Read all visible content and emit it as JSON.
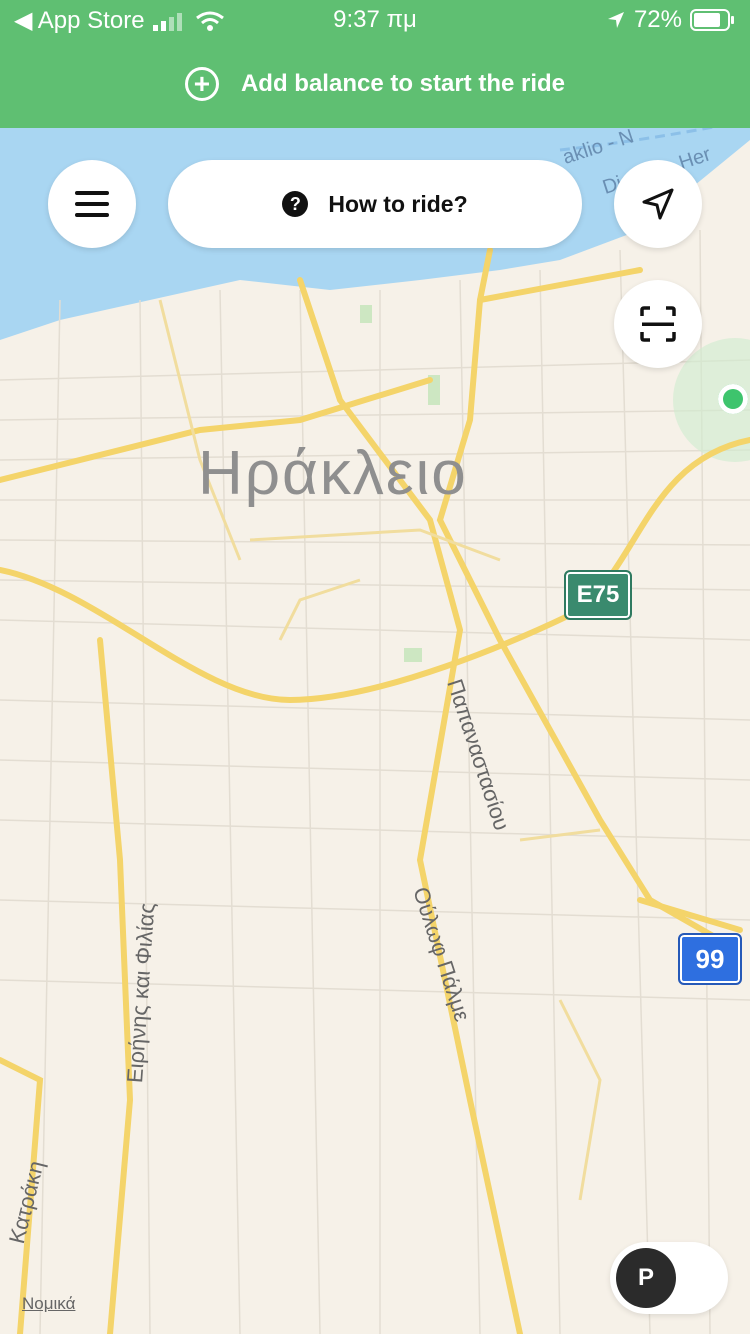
{
  "status_bar": {
    "back_label": "◀ App Store",
    "time": "9:37 πμ",
    "battery_percent": "72%"
  },
  "banner": {
    "label": "Add balance to start the ride"
  },
  "how_to_ride": {
    "label": "How to ride?"
  },
  "map": {
    "city_label": "Ηράκλειο",
    "port_label_1": "aklio - N",
    "port_label_2": "Diafani - Her",
    "shield_e75": "E75",
    "shield_99": "99",
    "street_1": "Παπαναστασίου",
    "street_2": "Ούλωφ Πάλμε",
    "street_3": "Ειρήνης και Φιλίας",
    "street_4": "Κατράκη",
    "legal_label": "Νομικά"
  },
  "parking": {
    "label": "P"
  },
  "colors": {
    "accent": "#5fbf72",
    "sea": "#a9d6f2",
    "road": "#f4d46a"
  }
}
